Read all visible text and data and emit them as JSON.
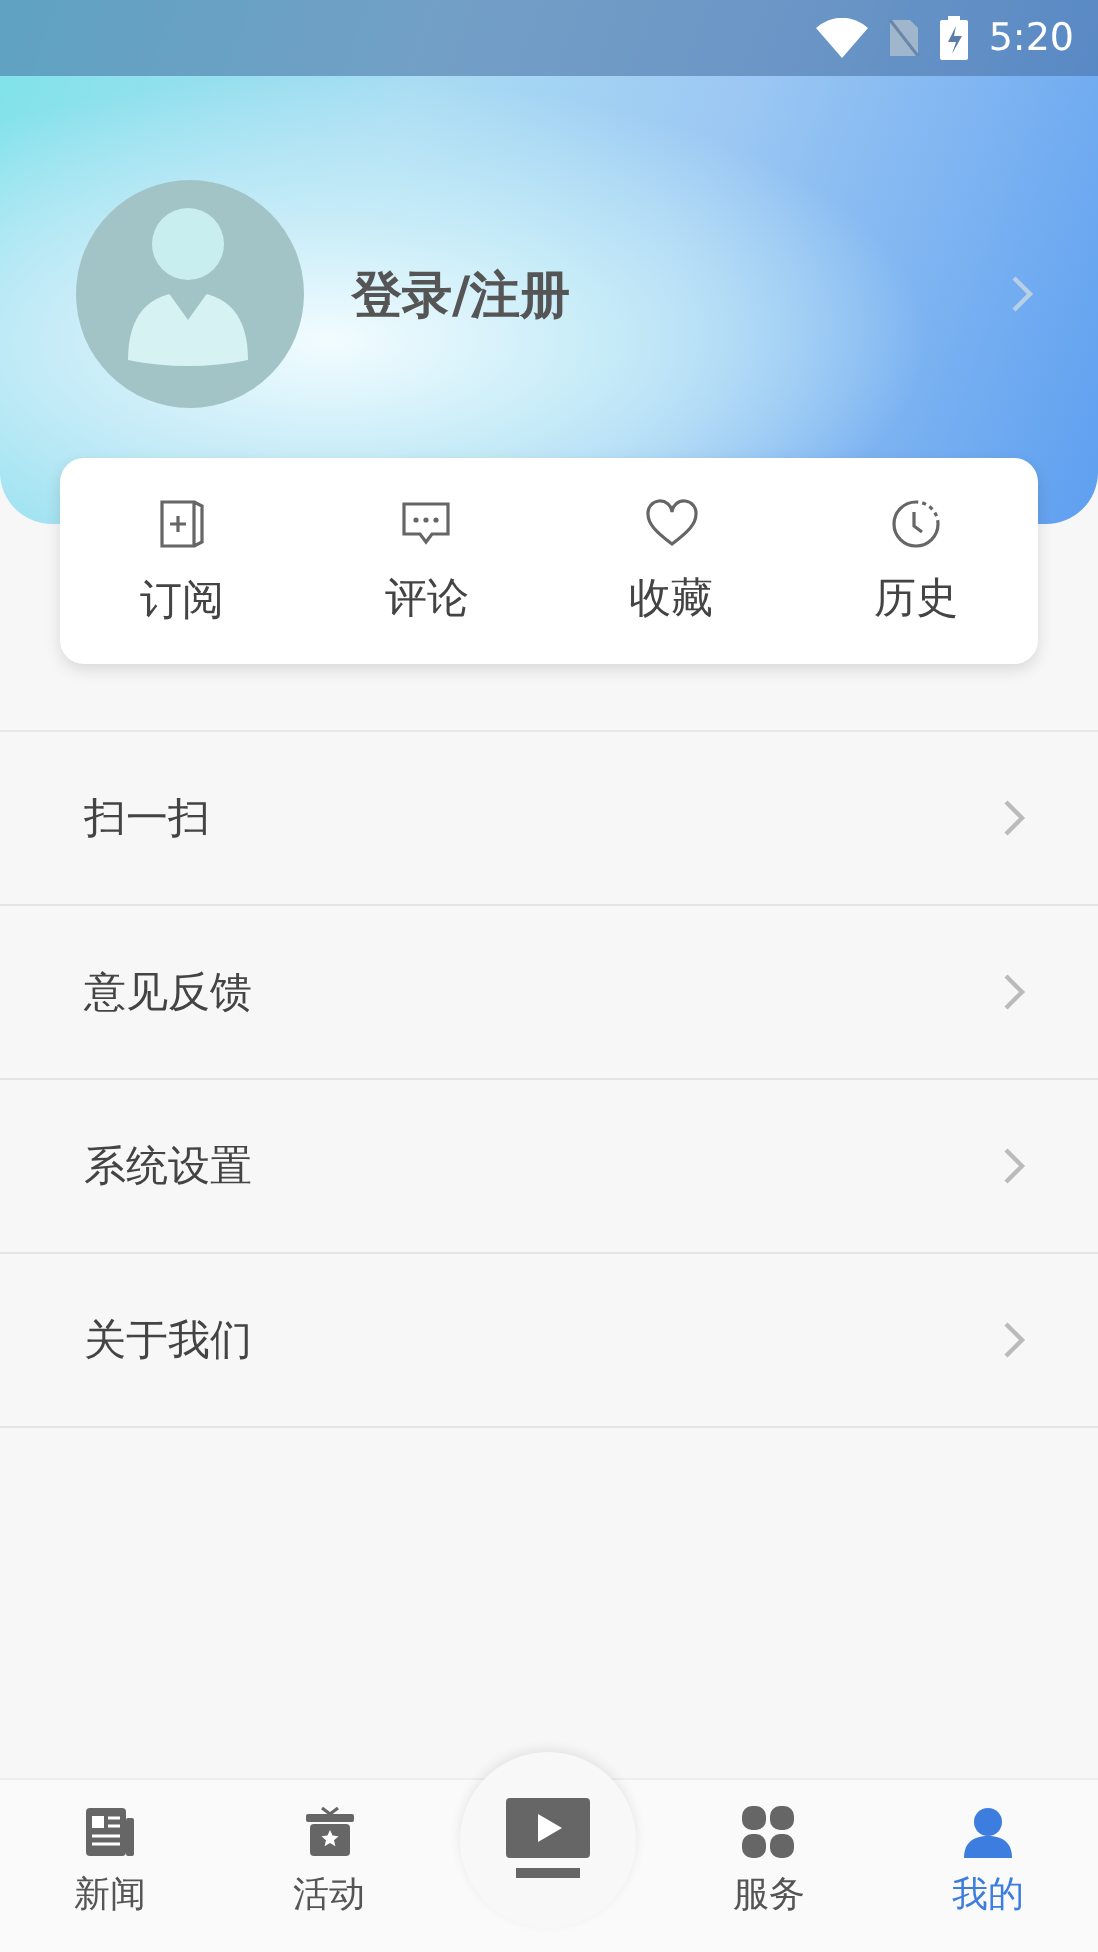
{
  "status_bar": {
    "time": "5:20"
  },
  "profile": {
    "login_label": "登录/注册"
  },
  "quick_actions": [
    {
      "kind": "subscribe",
      "label": "订阅"
    },
    {
      "kind": "comment",
      "label": "评论"
    },
    {
      "kind": "favorite",
      "label": "收藏"
    },
    {
      "kind": "history",
      "label": "历史"
    }
  ],
  "menu": [
    {
      "label": "扫一扫"
    },
    {
      "label": "意见反馈"
    },
    {
      "label": "系统设置"
    },
    {
      "label": "关于我们"
    }
  ],
  "tabs": [
    {
      "kind": "news",
      "label": "新闻",
      "selected": false
    },
    {
      "kind": "events",
      "label": "活动",
      "selected": false
    },
    {
      "kind": "video",
      "selected": false
    },
    {
      "kind": "services",
      "label": "服务",
      "selected": false
    },
    {
      "kind": "mine",
      "label": "我的",
      "selected": true
    }
  ]
}
